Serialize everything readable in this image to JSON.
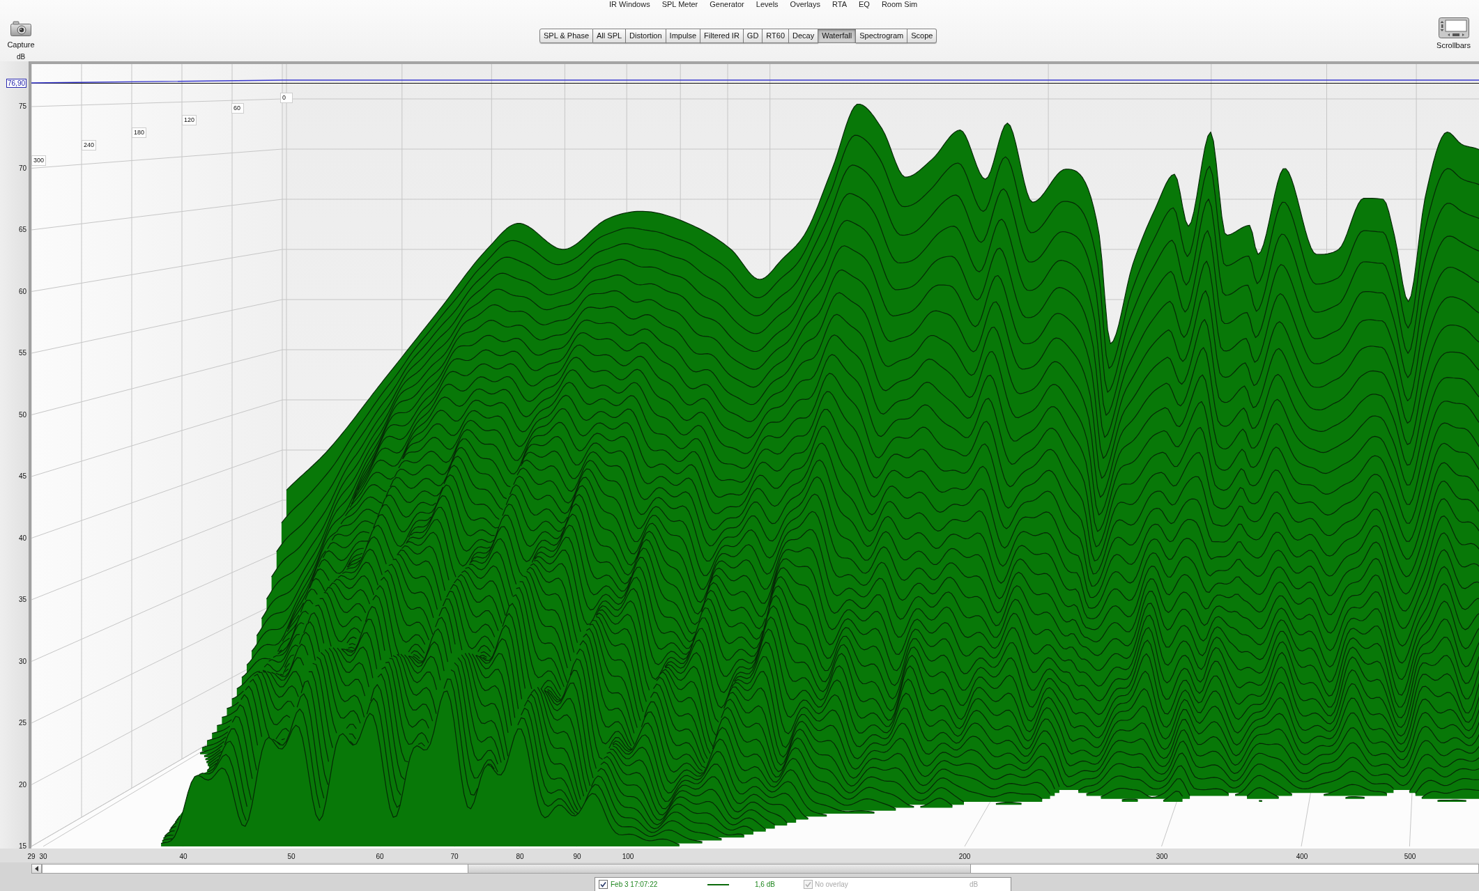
{
  "toolbar": {
    "buttons": [
      {
        "label": "IR Windows"
      },
      {
        "label": "SPL Meter"
      },
      {
        "label": "Generator"
      },
      {
        "label": "Levels"
      },
      {
        "label": "Overlays"
      },
      {
        "label": "RTA"
      },
      {
        "label": "EQ"
      },
      {
        "label": "Room Sim"
      }
    ],
    "capture": {
      "label": "Capture"
    },
    "scrollbars": {
      "label": "Scrollbars"
    }
  },
  "tabs": [
    {
      "label": "SPL & Phase",
      "selected": false
    },
    {
      "label": "All SPL",
      "selected": false
    },
    {
      "label": "Distortion",
      "selected": false
    },
    {
      "label": "Impulse",
      "selected": false
    },
    {
      "label": "Filtered IR",
      "selected": false
    },
    {
      "label": "GD",
      "selected": false
    },
    {
      "label": "RT60",
      "selected": false
    },
    {
      "label": "Decay",
      "selected": false
    },
    {
      "label": "Waterfall",
      "selected": true
    },
    {
      "label": "Spectrogram",
      "selected": false
    },
    {
      "label": "Scope",
      "selected": false
    }
  ],
  "graph": {
    "y_unit": "dB",
    "cursor_readout": "76,90",
    "y_ticks": [
      "75",
      "70",
      "65",
      "60",
      "55",
      "50",
      "45",
      "40",
      "35",
      "30",
      "25",
      "20",
      "15"
    ],
    "time_ticks": [
      "300",
      "240",
      "180",
      "120",
      "60",
      "0"
    ],
    "x_ticks": [
      "29",
      "30",
      "40",
      "50",
      "60",
      "70",
      "80",
      "90",
      "100",
      "200",
      "300",
      "400",
      "500"
    ]
  },
  "legend": [
    {
      "kind": "measurement",
      "checked": true,
      "disabled": false,
      "label": "Feb 3 17:07:22",
      "value": "1,6 dB"
    },
    {
      "kind": "overlay",
      "checked": true,
      "disabled": true,
      "label": "No overlay",
      "value": "dB"
    }
  ]
}
